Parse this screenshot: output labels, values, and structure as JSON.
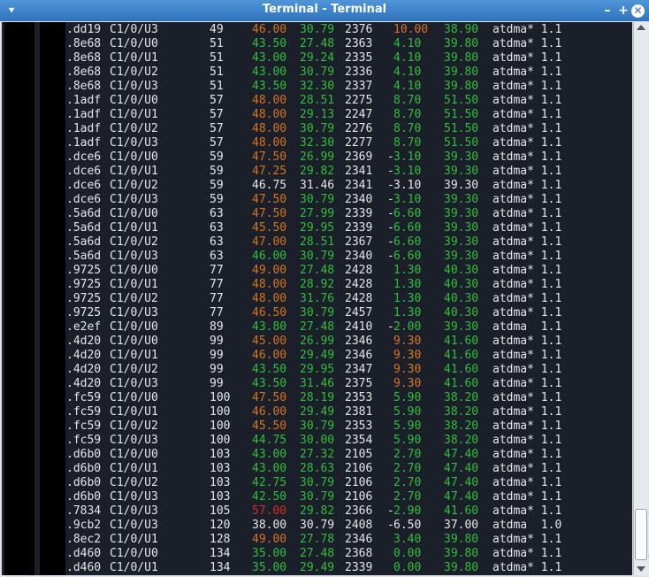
{
  "window": {
    "title": "Terminal - Terminal",
    "menu_icon": "menu-chevron-icon",
    "minimize_icon": "minimize-icon",
    "maximize_icon": "maximize-icon",
    "close_icon": "close-icon"
  },
  "rows": [
    {
      "id": ".dd19",
      "port": "C1/0/U3",
      "num": "49",
      "c4": "46.00",
      "c4c": "o",
      "c5": "30.79",
      "c5c": "g",
      "c6": "2376",
      "dash": "",
      "c8": "10.00",
      "c8c": "o",
      "c9": "38.90",
      "c9c": "g",
      "mod": "atdma* 1.1"
    },
    {
      "id": ".8e68",
      "port": "C1/0/U0",
      "num": "51",
      "c4": "43.50",
      "c4c": "g",
      "c5": "27.48",
      "c5c": "g",
      "c6": "2363",
      "dash": "",
      "c8": "4.10",
      "c8c": "g",
      "c9": "39.80",
      "c9c": "g",
      "mod": "atdma* 1.1"
    },
    {
      "id": ".8e68",
      "port": "C1/0/U1",
      "num": "51",
      "c4": "43.00",
      "c4c": "g",
      "c5": "29.24",
      "c5c": "g",
      "c6": "2335",
      "dash": "",
      "c8": "4.10",
      "c8c": "g",
      "c9": "39.80",
      "c9c": "g",
      "mod": "atdma* 1.1"
    },
    {
      "id": ".8e68",
      "port": "C1/0/U2",
      "num": "51",
      "c4": "43.00",
      "c4c": "g",
      "c5": "30.79",
      "c5c": "g",
      "c6": "2336",
      "dash": "",
      "c8": "4.10",
      "c8c": "g",
      "c9": "39.80",
      "c9c": "g",
      "mod": "atdma* 1.1"
    },
    {
      "id": ".8e68",
      "port": "C1/0/U3",
      "num": "51",
      "c4": "43.50",
      "c4c": "g",
      "c5": "32.30",
      "c5c": "g",
      "c6": "2337",
      "dash": "",
      "c8": "4.10",
      "c8c": "g",
      "c9": "39.80",
      "c9c": "g",
      "mod": "atdma* 1.1"
    },
    {
      "id": ".1adf",
      "port": "C1/0/U0",
      "num": "57",
      "c4": "48.00",
      "c4c": "o",
      "c5": "28.51",
      "c5c": "g",
      "c6": "2275",
      "dash": "",
      "c8": "8.70",
      "c8c": "g",
      "c9": "51.50",
      "c9c": "g",
      "mod": "atdma* 1.1"
    },
    {
      "id": ".1adf",
      "port": "C1/0/U1",
      "num": "57",
      "c4": "48.00",
      "c4c": "o",
      "c5": "29.13",
      "c5c": "g",
      "c6": "2247",
      "dash": "",
      "c8": "8.70",
      "c8c": "g",
      "c9": "51.50",
      "c9c": "g",
      "mod": "atdma* 1.1"
    },
    {
      "id": ".1adf",
      "port": "C1/0/U2",
      "num": "57",
      "c4": "48.00",
      "c4c": "o",
      "c5": "30.79",
      "c5c": "g",
      "c6": "2276",
      "dash": "",
      "c8": "8.70",
      "c8c": "g",
      "c9": "51.50",
      "c9c": "g",
      "mod": "atdma* 1.1"
    },
    {
      "id": ".1adf",
      "port": "C1/0/U3",
      "num": "57",
      "c4": "48.00",
      "c4c": "o",
      "c5": "32.30",
      "c5c": "g",
      "c6": "2277",
      "dash": "",
      "c8": "8.70",
      "c8c": "g",
      "c9": "51.50",
      "c9c": "g",
      "mod": "atdma* 1.1"
    },
    {
      "id": ".dce6",
      "port": "C1/0/U0",
      "num": "59",
      "c4": "47.50",
      "c4c": "o",
      "c5": "26.99",
      "c5c": "g",
      "c6": "2369",
      "dash": "-",
      "c8": "3.10",
      "c8c": "g",
      "c9": "39.30",
      "c9c": "g",
      "mod": "atdma* 1.1"
    },
    {
      "id": ".dce6",
      "port": "C1/0/U1",
      "num": "59",
      "c4": "47.25",
      "c4c": "o",
      "c5": "29.82",
      "c5c": "g",
      "c6": "2341",
      "dash": "-",
      "c8": "3.10",
      "c8c": "g",
      "c9": "39.30",
      "c9c": "g",
      "mod": "atdma* 1.1"
    },
    {
      "id": ".dce6",
      "port": "C1/0/U2",
      "num": "59",
      "c4": "46.75",
      "c4c": "w",
      "c5": "31.46",
      "c5c": "w",
      "c6": "2341",
      "dash": "-",
      "c8": "3.10",
      "c8c": "w",
      "c9": "39.30",
      "c9c": "w",
      "mod": "atdma* 1.1"
    },
    {
      "id": ".dce6",
      "port": "C1/0/U3",
      "num": "59",
      "c4": "47.50",
      "c4c": "o",
      "c5": "30.79",
      "c5c": "g",
      "c6": "2340",
      "dash": "-",
      "c8": "3.10",
      "c8c": "g",
      "c9": "39.30",
      "c9c": "g",
      "mod": "atdma* 1.1"
    },
    {
      "id": ".5a6d",
      "port": "C1/0/U0",
      "num": "63",
      "c4": "47.50",
      "c4c": "o",
      "c5": "27.99",
      "c5c": "g",
      "c6": "2339",
      "dash": "-",
      "c8": "6.60",
      "c8c": "g",
      "c9": "39.30",
      "c9c": "g",
      "mod": "atdma* 1.1"
    },
    {
      "id": ".5a6d",
      "port": "C1/0/U1",
      "num": "63",
      "c4": "45.50",
      "c4c": "o",
      "c5": "29.95",
      "c5c": "g",
      "c6": "2339",
      "dash": "-",
      "c8": "6.60",
      "c8c": "g",
      "c9": "39.30",
      "c9c": "g",
      "mod": "atdma* 1.1"
    },
    {
      "id": ".5a6d",
      "port": "C1/0/U2",
      "num": "63",
      "c4": "47.00",
      "c4c": "o",
      "c5": "28.51",
      "c5c": "g",
      "c6": "2367",
      "dash": "-",
      "c8": "6.60",
      "c8c": "g",
      "c9": "39.30",
      "c9c": "g",
      "mod": "atdma* 1.1"
    },
    {
      "id": ".5a6d",
      "port": "C1/0/U3",
      "num": "63",
      "c4": "46.00",
      "c4c": "g",
      "c5": "30.79",
      "c5c": "g",
      "c6": "2340",
      "dash": "-",
      "c8": "6.60",
      "c8c": "g",
      "c9": "39.30",
      "c9c": "g",
      "mod": "atdma* 1.1"
    },
    {
      "id": ".9725",
      "port": "C1/0/U0",
      "num": "77",
      "c4": "49.00",
      "c4c": "o",
      "c5": "27.48",
      "c5c": "g",
      "c6": "2428",
      "dash": "",
      "c8": "1.30",
      "c8c": "g",
      "c9": "40.30",
      "c9c": "g",
      "mod": "atdma* 1.1"
    },
    {
      "id": ".9725",
      "port": "C1/0/U1",
      "num": "77",
      "c4": "48.00",
      "c4c": "o",
      "c5": "28.92",
      "c5c": "g",
      "c6": "2428",
      "dash": "",
      "c8": "1.30",
      "c8c": "g",
      "c9": "40.30",
      "c9c": "g",
      "mod": "atdma* 1.1"
    },
    {
      "id": ".9725",
      "port": "C1/0/U2",
      "num": "77",
      "c4": "48.00",
      "c4c": "o",
      "c5": "31.76",
      "c5c": "g",
      "c6": "2428",
      "dash": "",
      "c8": "1.30",
      "c8c": "g",
      "c9": "40.30",
      "c9c": "g",
      "mod": "atdma* 1.1"
    },
    {
      "id": ".9725",
      "port": "C1/0/U3",
      "num": "77",
      "c4": "46.50",
      "c4c": "o",
      "c5": "30.79",
      "c5c": "g",
      "c6": "2457",
      "dash": "",
      "c8": "1.30",
      "c8c": "g",
      "c9": "40.30",
      "c9c": "g",
      "mod": "atdma* 1.1"
    },
    {
      "id": ".e2ef",
      "port": "C1/0/U0",
      "num": "89",
      "c4": "43.80",
      "c4c": "g",
      "c5": "27.48",
      "c5c": "g",
      "c6": "2410",
      "dash": "-",
      "c8": "2.00",
      "c8c": "g",
      "c9": "39.30",
      "c9c": "g",
      "mod": "atdma  1.1"
    },
    {
      "id": ".4d20",
      "port": "C1/0/U0",
      "num": "99",
      "c4": "45.00",
      "c4c": "o",
      "c5": "26.99",
      "c5c": "g",
      "c6": "2346",
      "dash": "",
      "c8": "9.30",
      "c8c": "o",
      "c9": "41.60",
      "c9c": "g",
      "mod": "atdma* 1.1"
    },
    {
      "id": ".4d20",
      "port": "C1/0/U1",
      "num": "99",
      "c4": "46.00",
      "c4c": "o",
      "c5": "29.49",
      "c5c": "g",
      "c6": "2346",
      "dash": "",
      "c8": "9.30",
      "c8c": "o",
      "c9": "41.60",
      "c9c": "g",
      "mod": "atdma* 1.1"
    },
    {
      "id": ".4d20",
      "port": "C1/0/U2",
      "num": "99",
      "c4": "43.50",
      "c4c": "g",
      "c5": "29.95",
      "c5c": "g",
      "c6": "2347",
      "dash": "",
      "c8": "9.30",
      "c8c": "o",
      "c9": "41.60",
      "c9c": "g",
      "mod": "atdma* 1.1"
    },
    {
      "id": ".4d20",
      "port": "C1/0/U3",
      "num": "99",
      "c4": "43.50",
      "c4c": "g",
      "c5": "31.46",
      "c5c": "g",
      "c6": "2375",
      "dash": "",
      "c8": "9.30",
      "c8c": "o",
      "c9": "41.60",
      "c9c": "g",
      "mod": "atdma* 1.1"
    },
    {
      "id": ".fc59",
      "port": "C1/0/U0",
      "num": "100",
      "c4": "47.50",
      "c4c": "o",
      "c5": "28.19",
      "c5c": "g",
      "c6": "2353",
      "dash": "",
      "c8": "5.90",
      "c8c": "g",
      "c9": "38.20",
      "c9c": "g",
      "mod": "atdma* 1.1"
    },
    {
      "id": ".fc59",
      "port": "C1/0/U1",
      "num": "100",
      "c4": "46.00",
      "c4c": "o",
      "c5": "29.49",
      "c5c": "g",
      "c6": "2381",
      "dash": "",
      "c8": "5.90",
      "c8c": "g",
      "c9": "38.20",
      "c9c": "g",
      "mod": "atdma* 1.1"
    },
    {
      "id": ".fc59",
      "port": "C1/0/U2",
      "num": "100",
      "c4": "45.50",
      "c4c": "o",
      "c5": "30.79",
      "c5c": "g",
      "c6": "2353",
      "dash": "",
      "c8": "5.90",
      "c8c": "g",
      "c9": "38.20",
      "c9c": "g",
      "mod": "atdma* 1.1"
    },
    {
      "id": ".fc59",
      "port": "C1/0/U3",
      "num": "100",
      "c4": "44.75",
      "c4c": "g",
      "c5": "30.00",
      "c5c": "g",
      "c6": "2354",
      "dash": "",
      "c8": "5.90",
      "c8c": "g",
      "c9": "38.20",
      "c9c": "g",
      "mod": "atdma* 1.1"
    },
    {
      "id": ".d6b0",
      "port": "C1/0/U0",
      "num": "103",
      "c4": "43.00",
      "c4c": "g",
      "c5": "27.32",
      "c5c": "g",
      "c6": "2105",
      "dash": "",
      "c8": "2.70",
      "c8c": "g",
      "c9": "47.40",
      "c9c": "g",
      "mod": "atdma* 1.1"
    },
    {
      "id": ".d6b0",
      "port": "C1/0/U1",
      "num": "103",
      "c4": "43.00",
      "c4c": "g",
      "c5": "28.63",
      "c5c": "g",
      "c6": "2106",
      "dash": "",
      "c8": "2.70",
      "c8c": "g",
      "c9": "47.40",
      "c9c": "g",
      "mod": "atdma* 1.1"
    },
    {
      "id": ".d6b0",
      "port": "C1/0/U2",
      "num": "103",
      "c4": "42.75",
      "c4c": "g",
      "c5": "30.79",
      "c5c": "g",
      "c6": "2106",
      "dash": "",
      "c8": "2.70",
      "c8c": "g",
      "c9": "47.40",
      "c9c": "g",
      "mod": "atdma* 1.1"
    },
    {
      "id": ".d6b0",
      "port": "C1/0/U3",
      "num": "103",
      "c4": "42.50",
      "c4c": "g",
      "c5": "30.79",
      "c5c": "g",
      "c6": "2106",
      "dash": "",
      "c8": "2.70",
      "c8c": "g",
      "c9": "47.40",
      "c9c": "g",
      "mod": "atdma* 1.1"
    },
    {
      "id": ".7834",
      "port": "C1/0/U3",
      "num": "105",
      "c4": "57.00",
      "c4c": "r",
      "c5": "29.82",
      "c5c": "g",
      "c6": "2366",
      "dash": "-",
      "c8": "2.90",
      "c8c": "g",
      "c9": "41.60",
      "c9c": "g",
      "mod": "atdma* 1.1"
    },
    {
      "id": ".9cb2",
      "port": "C1/0/U3",
      "num": "120",
      "c4": "38.00",
      "c4c": "w",
      "c5": "30.79",
      "c5c": "w",
      "c6": "2408",
      "dash": "-",
      "c8": "6.50",
      "c8c": "w",
      "c9": "37.00",
      "c9c": "w",
      "mod": "atdma  1.0"
    },
    {
      "id": ".8ec2",
      "port": "C1/0/U1",
      "num": "128",
      "c4": "49.00",
      "c4c": "o",
      "c5": "27.78",
      "c5c": "g",
      "c6": "2346",
      "dash": "",
      "c8": "3.40",
      "c8c": "g",
      "c9": "39.80",
      "c9c": "g",
      "mod": "atdma* 1.1"
    },
    {
      "id": ".d460",
      "port": "C1/0/U0",
      "num": "134",
      "c4": "35.00",
      "c4c": "g",
      "c5": "27.48",
      "c5c": "g",
      "c6": "2368",
      "dash": "",
      "c8": "0.00",
      "c8c": "g",
      "c9": "39.80",
      "c9c": "g",
      "mod": "atdma* 1.1"
    },
    {
      "id": ".d460",
      "port": "C1/0/U1",
      "num": "134",
      "c4": "35.00",
      "c4c": "g",
      "c5": "29.49",
      "c5c": "g",
      "c6": "2339",
      "dash": "",
      "c8": "0.00",
      "c8c": "g",
      "c9": "39.80",
      "c9c": "g",
      "mod": "atdma* 1.1"
    }
  ]
}
